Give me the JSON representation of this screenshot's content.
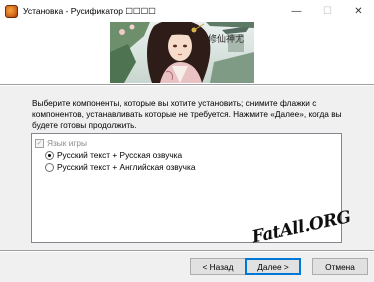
{
  "window": {
    "title": "Установка - Русификатор ☐☐☐☐",
    "minimize_glyph": "—",
    "maximize_glyph": "☐",
    "close_glyph": "✕"
  },
  "banner": {
    "calligraphy": "修仙神尤"
  },
  "page": {
    "description": "Выберите компоненты, которые вы хотите установить; снимите флажки с компонентов, устанавливать которые не требуется. Нажмите «Далее», когда вы будете готовы продолжить."
  },
  "components": {
    "group_label": "Язык игры",
    "group_check_glyph": "✓",
    "options": [
      {
        "label": "Русский текст + Русская озвучка",
        "selected": true
      },
      {
        "label": "Русский текст + Английская озвучка",
        "selected": false
      }
    ]
  },
  "watermark": {
    "text": "FatAll.ORG"
  },
  "buttons": {
    "back": "< Назад",
    "next": "Далее >",
    "cancel": "Отмена"
  },
  "colors": {
    "titlebar_bg": "#ffffff",
    "dialog_bg": "#f0f0f0",
    "default_button_border": "#0078d7"
  }
}
